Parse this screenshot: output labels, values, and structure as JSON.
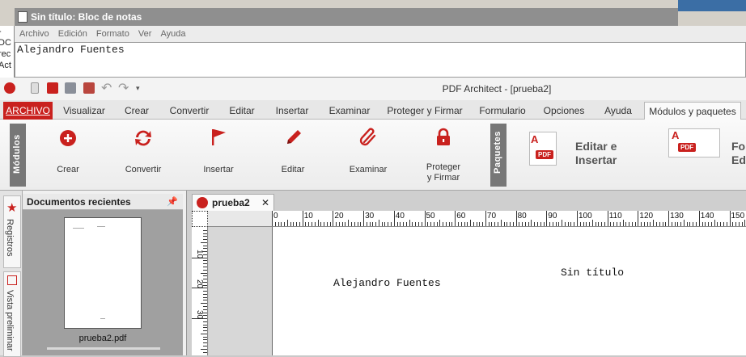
{
  "notepad": {
    "title": "Sin título: Bloc de notas",
    "menu": [
      "Archivo",
      "Edición",
      "Formato",
      "Ver",
      "Ayuda"
    ],
    "content": "Alejandro Fuentes",
    "behind_text": [
      "-DC",
      "rec",
      "Act"
    ]
  },
  "app": {
    "title": "PDF Architect - [prueba2]",
    "tabs": [
      "ARCHIVO",
      "Visualizar",
      "Crear",
      "Convertir",
      "Editar",
      "Insertar",
      "Examinar",
      "Proteger y Firmar",
      "Formulario",
      "Opciones",
      "Ayuda",
      "Módulos y paquetes"
    ],
    "active_tab": "Módulos y paquetes",
    "accent": "#c9211e"
  },
  "ribbon": {
    "modules_label": "Módulos",
    "packages_label": "Paquetes",
    "buttons": [
      {
        "label": "Crear",
        "icon": "plus-circle-icon"
      },
      {
        "label": "Convertir",
        "icon": "convert-arrows-icon"
      },
      {
        "label": "Insertar",
        "icon": "flag-icon"
      },
      {
        "label": "Editar",
        "icon": "pencil-icon"
      },
      {
        "label": "Examinar",
        "icon": "paperclip-icon"
      },
      {
        "label": "Proteger\ny Firmar",
        "icon": "lock-icon"
      }
    ],
    "packages": [
      {
        "label": "Editar e\nInsertar"
      },
      {
        "label": "Fo\nEdi"
      }
    ]
  },
  "left_panel": {
    "vertical_tabs": [
      "Registros",
      "Vista preliminar"
    ],
    "header": "Documentos recientes",
    "thumb_name": "prueba2.pdf"
  },
  "document": {
    "tab_title": "prueba2",
    "ruler_numbers": [
      "0",
      "10",
      "20",
      "30",
      "40",
      "50",
      "60",
      "70",
      "80",
      "90",
      "100",
      "110",
      "120",
      "130",
      "140",
      "150"
    ],
    "vruler_numbers": [
      "10",
      "20",
      "30"
    ],
    "text_author": "Alejandro Fuentes",
    "text_title": "Sin título"
  }
}
